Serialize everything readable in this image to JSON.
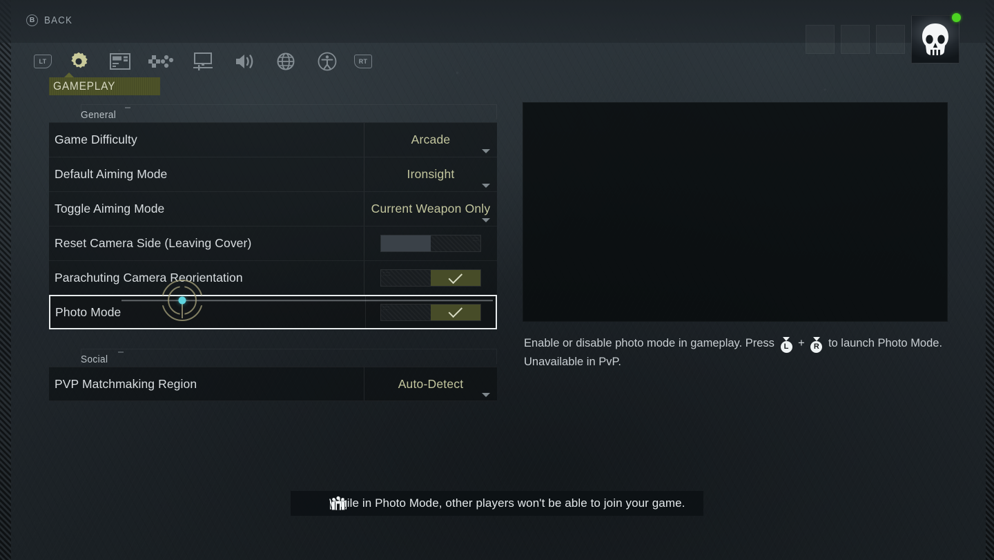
{
  "header": {
    "back_glyph": "B",
    "back_label": "BACK"
  },
  "tabs": [
    {
      "id": "lt-bumper",
      "icon": "lt-bumper-icon",
      "label": "LT",
      "selected": false
    },
    {
      "id": "gameplay",
      "icon": "gear-icon",
      "label": "GAMEPLAY",
      "selected": true
    },
    {
      "id": "interface",
      "icon": "hud-interface-icon",
      "label": "INTERFACE",
      "selected": false
    },
    {
      "id": "controls",
      "icon": "gamepad-icon",
      "label": "CONTROLS",
      "selected": false
    },
    {
      "id": "video",
      "icon": "display-icon",
      "label": "VIDEO",
      "selected": false
    },
    {
      "id": "audio",
      "icon": "speaker-icon",
      "label": "AUDIO",
      "selected": false
    },
    {
      "id": "online",
      "icon": "globe-icon",
      "label": "ONLINE",
      "selected": false
    },
    {
      "id": "accessibility",
      "icon": "accessibility-icon",
      "label": "ACCESSIBILITY",
      "selected": false
    },
    {
      "id": "rt-bumper",
      "icon": "rt-bumper-icon",
      "label": "RT",
      "selected": false
    }
  ],
  "active_tab_label": "GAMEPLAY",
  "sections": [
    {
      "title": "General",
      "rows": [
        {
          "label": "Game Difficulty",
          "type": "dropdown",
          "value": "Arcade"
        },
        {
          "label": "Default Aiming Mode",
          "type": "dropdown",
          "value": "Ironsight"
        },
        {
          "label": "Toggle Aiming Mode",
          "type": "dropdown",
          "value": "Current Weapon Only"
        },
        {
          "label": "Reset Camera Side (Leaving Cover)",
          "type": "toggle",
          "value": "Off"
        },
        {
          "label": "Parachuting Camera Reorientation",
          "type": "toggle",
          "value": "On"
        },
        {
          "label": "Photo Mode",
          "type": "toggle",
          "value": "On",
          "selected": true
        }
      ]
    },
    {
      "title": "Social",
      "rows": [
        {
          "label": "PVP Matchmaking Region",
          "type": "dropdown",
          "value": "Auto-Detect"
        }
      ]
    }
  ],
  "description": {
    "part1": "Enable or disable photo mode in gameplay. Press",
    "glyph_left": "L",
    "plus": "+",
    "glyph_right": "R",
    "part2": "to launch Photo Mode. Unavailable in PvP."
  },
  "toast": {
    "icon": "squad-group-icon",
    "text": "While in Photo Mode, other players won't be able to join your game."
  },
  "profile": {
    "avatar": "skull-avatar",
    "online_status": "online",
    "empty_slots": 3
  },
  "colors": {
    "accent_olive": "#4e5329",
    "accent_olive_toggle": "#474c28",
    "value_text": "#c3c69e",
    "selection_border": "#e8eced",
    "cursor_dot": "#5fd5e0",
    "online_dot": "#4cd321",
    "panel_bg": "#0a0d0f",
    "page_bg": "#232a2e"
  }
}
